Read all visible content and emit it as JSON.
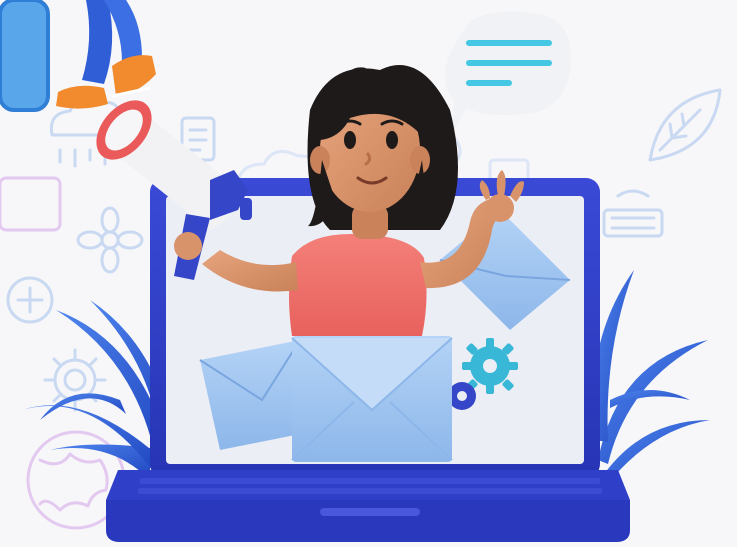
{
  "illustration": {
    "subject": "woman-with-megaphone-emerging-from-laptop",
    "icons": [
      "speech-bubble-icon",
      "megaphone-icon",
      "envelope-icon",
      "gear-icon",
      "leaf-icon",
      "keyboard-icon",
      "cloud-icon",
      "globe-icon",
      "plus-icon",
      "flower-icon",
      "document-icon"
    ],
    "colors": {
      "background": "#f7f7f9",
      "laptop_body": "#2f3fc8",
      "laptop_dark": "#1f2a9c",
      "screen": "#eceef5",
      "shirt": "#f0706a",
      "skin": "#d9936a",
      "hair": "#1f1a1a",
      "envelope": "#9dc3f0",
      "plant": "#2f5ed6",
      "megaphone_red": "#ea5a5a",
      "megaphone_blue": "#3547c8",
      "gear": "#38b7d6",
      "line_icons": "#c9d9f2"
    }
  }
}
